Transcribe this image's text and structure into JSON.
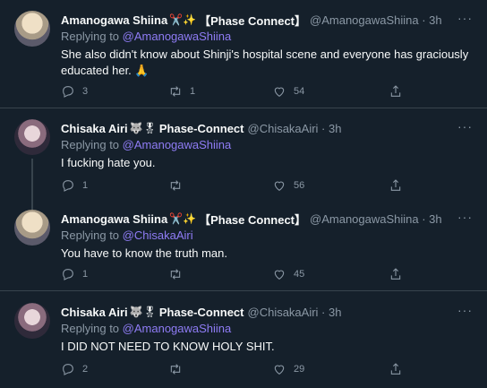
{
  "tweets": [
    {
      "name": "Amanogawa Shiina",
      "emoji": "✂️✨",
      "affiliation": "【Phase Connect】",
      "handle": "@AmanogawaShiina · 3h",
      "replying_prefix": "Replying to ",
      "replying_to": "@AmanogawaShiina",
      "text": "She also didn't know about Shinji's hospital scene and everyone has graciously educated her. 🙏",
      "replies": "3",
      "retweets": "1",
      "likes": "54"
    },
    {
      "name": "Chisaka Airi",
      "emoji": "🐺🎖",
      "affiliation": "Phase-Connect",
      "handle": "@ChisakaAiri · 3h",
      "replying_prefix": "Replying to ",
      "replying_to": "@AmanogawaShiina",
      "text": "I fucking hate you.",
      "replies": "1",
      "retweets": "",
      "likes": "56"
    },
    {
      "name": "Amanogawa Shiina",
      "emoji": "✂️✨",
      "affiliation": "【Phase Connect】",
      "handle": "@AmanogawaShiina · 3h",
      "replying_prefix": "Replying to ",
      "replying_to": "@ChisakaAiri",
      "text": "You have to know the truth man.",
      "replies": "1",
      "retweets": "",
      "likes": "45"
    },
    {
      "name": "Chisaka Airi",
      "emoji": "🐺🎖",
      "affiliation": "Phase-Connect",
      "handle": "@ChisakaAiri · 3h",
      "replying_prefix": "Replying to ",
      "replying_to": "@AmanogawaShiina",
      "text": "I DID NOT NEED TO KNOW HOLY SHIT.",
      "replies": "2",
      "retweets": "",
      "likes": "29"
    }
  ],
  "more_icon": "···",
  "icons": [
    "reply-icon",
    "retweet-icon",
    "like-icon",
    "share-icon"
  ]
}
